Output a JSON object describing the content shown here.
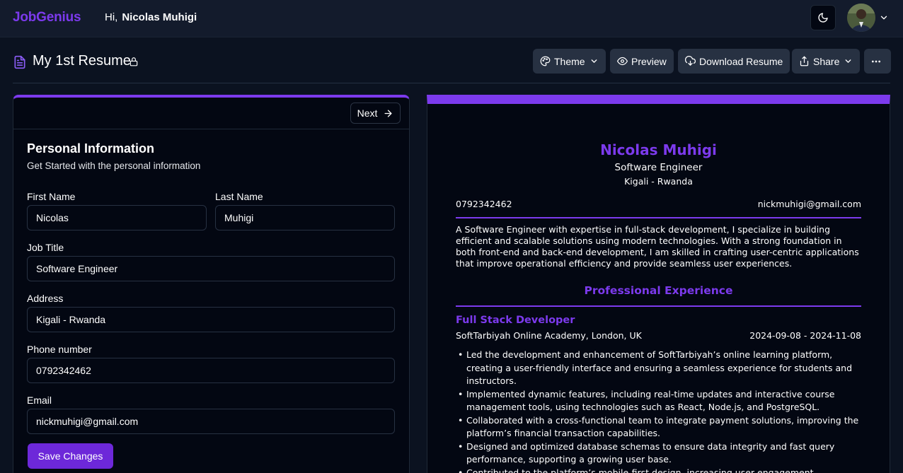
{
  "nav": {
    "brand": "JobGenius",
    "greeting": "Hi,",
    "user_name": "Nicolas Muhigi"
  },
  "header": {
    "title": "My 1st Resume",
    "buttons": {
      "theme": "Theme",
      "preview": "Preview",
      "download": "Download Resume",
      "share": "Share"
    }
  },
  "form": {
    "next_label": "Next",
    "section_title": "Personal Information",
    "section_subtitle": "Get Started with the personal information",
    "fields": {
      "first_name": {
        "label": "First Name",
        "value": "Nicolas"
      },
      "last_name": {
        "label": "Last Name",
        "value": "Muhigi"
      },
      "job_title": {
        "label": "Job Title",
        "value": "Software Engineer"
      },
      "address": {
        "label": "Address",
        "value": "Kigali - Rwanda"
      },
      "phone": {
        "label": "Phone number",
        "value": "0792342462"
      },
      "email": {
        "label": "Email",
        "value": "nickmuhigi@gmail.com"
      }
    },
    "save_label": "Save Changes"
  },
  "preview": {
    "name": "Nicolas Muhigi",
    "job_title": "Software Engineer",
    "address": "Kigali - Rwanda",
    "phone": "0792342462",
    "email": "nickmuhigi@gmail.com",
    "summary": "A Software Engineer with expertise in full-stack development, I specialize in building efficient and scalable solutions using modern technologies. With a strong foundation in both front-end and back-end development, I am skilled in crafting user-centric applications that improve operational efficiency and provide seamless user experiences.",
    "experience_heading": "Professional Experience",
    "experience": [
      {
        "role": "Full Stack Developer",
        "company": "SoftTarbiyah Online Academy, London, UK",
        "dates": "2024-09-08 - 2024-11-08",
        "bullets": [
          "Led the development and enhancement of SoftTarbiyah’s online learning platform, creating a user-friendly interface and ensuring a seamless experience for students and instructors.",
          "Implemented dynamic features, including real-time updates and interactive course management tools, using technologies such as React, Node.js, and PostgreSQL.",
          "Collaborated with a cross-functional team to integrate payment solutions, improving the platform’s financial transaction capabilities.",
          "Designed and optimized database schemas to ensure data integrity and fast query performance, supporting a growing user base.",
          "Contributed to the platform’s mobile-first design, increasing user engagement."
        ]
      }
    ]
  },
  "colors": {
    "accent": "#7c3aed",
    "page_bg": "#0b1220",
    "nav_bg": "#131b2c",
    "panel_bg": "#030712",
    "button_bg": "#273142"
  },
  "icons": {
    "theme_toggle": "moon-icon",
    "title_doc": "document-icon",
    "title_lock": "lock-icon",
    "theme": "palette-icon",
    "preview": "eye-icon",
    "download": "cloud-download-icon",
    "share": "share-icon",
    "more": "more-horizontal-icon",
    "next": "arrow-right-icon"
  }
}
